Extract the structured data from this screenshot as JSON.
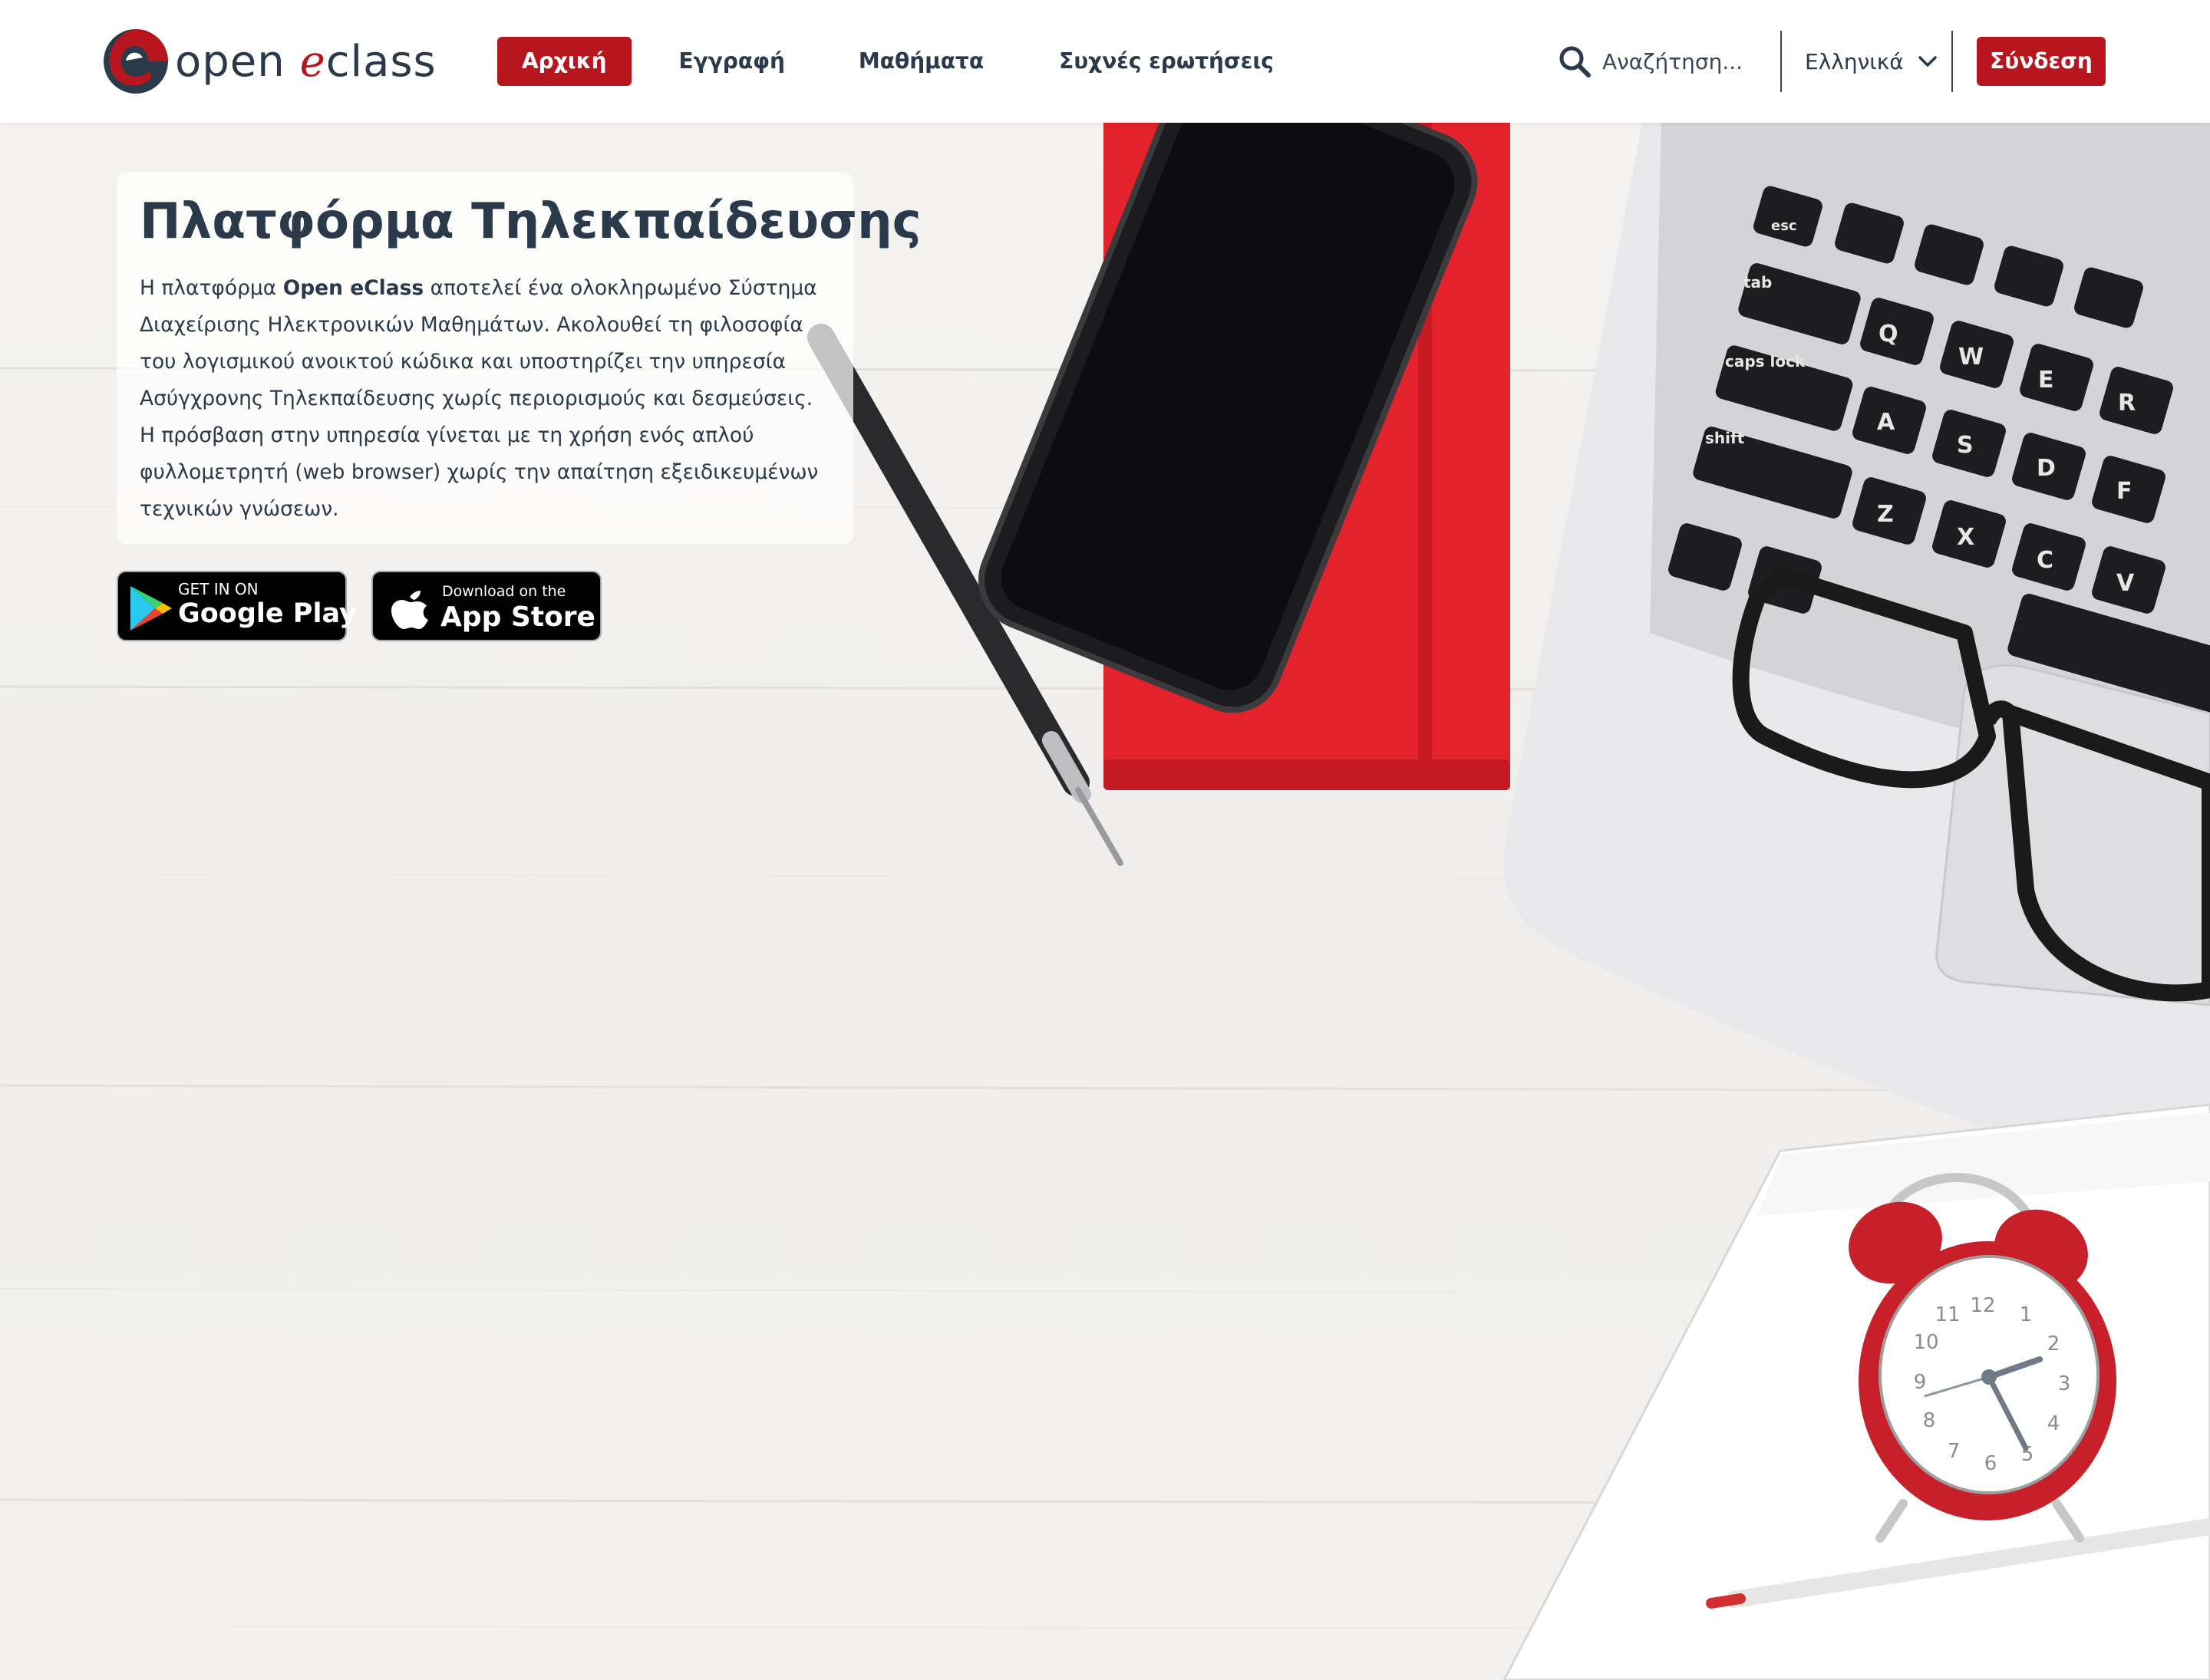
{
  "header": {
    "logo": {
      "text_open": "open",
      "text_e": "e",
      "text_class": "class",
      "icon": "eclass-logo-icon"
    },
    "nav": [
      {
        "label": "Αρχική",
        "active": true
      },
      {
        "label": "Εγγραφή",
        "active": false
      },
      {
        "label": "Μαθήματα",
        "active": false
      },
      {
        "label": "Συχνές ερωτήσεις",
        "active": false
      }
    ],
    "search": {
      "placeholder": "Αναζήτηση...",
      "value": "",
      "icon": "search-icon"
    },
    "language": {
      "selected": "Ελληνικά",
      "icon": "chevron-down-icon"
    },
    "login_label": "Σύνδεση"
  },
  "hero": {
    "title": "Πλατφόρμα Τηλεκπαίδευσης",
    "text_before": "Η πλατφόρμα ",
    "text_bold": "Open eClass",
    "text_after": " αποτελεί ένα ολοκληρωμένο Σύστημα Διαχείρισης Ηλεκτρονικών Μαθημάτων. Ακολουθεί τη φιλοσοφία του λογισμικού ανοικτού κώδικα και υποστηρίζει την υπηρεσία Ασύγχρονης Τηλεκπαίδευσης χωρίς περιορισμούς και δεσμεύσεις. Η πρόσβαση στην υπηρεσία γίνεται με τη χρήση ενός απλού φυλλομετρητή (web browser) χωρίς την απαίτηση εξειδικευμένων τεχνικών γνώσεων.",
    "background_keys": [
      "esc",
      "tab",
      "caps lock",
      "shift",
      "Q",
      "W",
      "E",
      "R",
      "A",
      "S",
      "D",
      "F",
      "Z",
      "X",
      "C",
      "V"
    ],
    "clock_numbers": [
      "12",
      "1",
      "2",
      "3",
      "4",
      "5",
      "6",
      "7",
      "8",
      "9",
      "10",
      "11"
    ]
  },
  "badges": {
    "google": {
      "small": "GET IN ON",
      "big": "Google Play",
      "icon": "google-play-icon"
    },
    "apple": {
      "small": "Download on the",
      "big": "App Store",
      "icon": "apple-icon"
    }
  },
  "colors": {
    "brand_red": "#b7161e",
    "text_dark": "#2b3a4a",
    "notebook_red": "#e3222c",
    "header_bg": "#ffffff"
  }
}
